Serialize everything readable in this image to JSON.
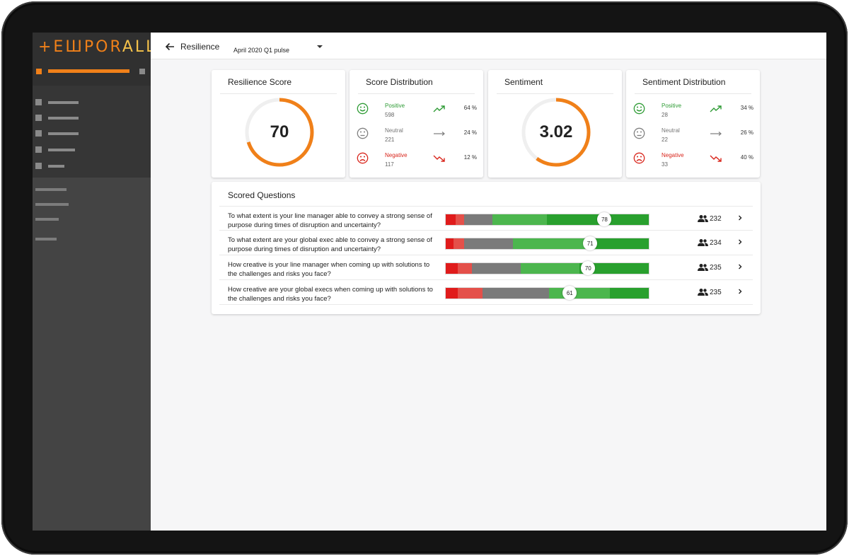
{
  "brand": {
    "logo_head": "+EШPOR",
    "logo_tail": "ALL",
    "accent": "#f08019"
  },
  "header": {
    "title": "Resilience",
    "pulse": "April 2020 Q1 pulse"
  },
  "resilience_score": {
    "title": "Resilience Score",
    "value": "70",
    "fraction": 0.7
  },
  "score_distribution": {
    "title": "Score Distribution",
    "rows": [
      {
        "label": "Positive",
        "count": "598",
        "pct": "64 %",
        "color": "#2e9b35"
      },
      {
        "label": "Neutral",
        "count": "221",
        "pct": "24 %",
        "color": "#808080"
      },
      {
        "label": "Negative",
        "count": "117",
        "pct": "12 %",
        "color": "#d9261c"
      }
    ]
  },
  "sentiment": {
    "title": "Sentiment",
    "value": "3.02",
    "fraction": 0.6
  },
  "sentiment_distribution": {
    "title": "Sentiment Distribution",
    "rows": [
      {
        "label": "Positive",
        "count": "28",
        "pct": "34 %",
        "color": "#2e9b35"
      },
      {
        "label": "Neutral",
        "count": "22",
        "pct": "26 %",
        "color": "#808080"
      },
      {
        "label": "Negative",
        "count": "33",
        "pct": "40 %",
        "color": "#d9261c"
      }
    ]
  },
  "scored_questions": {
    "title": "Scored Questions",
    "segment_colors": [
      "#e01b1b",
      "#e4504a",
      "#7a7a7a",
      "#4cb64e",
      "#29a02e"
    ],
    "items": [
      {
        "text": "To what extent is your line manager able to convey a strong sense of purpose during times of disruption and uncertainty?",
        "score": "78",
        "score_value": 78,
        "segments": [
          0.05,
          0.04,
          0.14,
          0.27,
          0.5
        ],
        "respondents": "232"
      },
      {
        "text": "To what extent are your global exec able to convey a strong sense of purpose during times of disruption and uncertainty?",
        "score": "71",
        "score_value": 71,
        "segments": [
          0.04,
          0.05,
          0.24,
          0.41,
          0.26
        ],
        "respondents": "234"
      },
      {
        "text": "How creative is your line manager when coming up with solutions to the challenges and risks you face?",
        "score": "70",
        "score_value": 70,
        "segments": [
          0.06,
          0.07,
          0.24,
          0.29,
          0.34
        ],
        "respondents": "235"
      },
      {
        "text": "How creative are your global execs when coming up with solutions to the challenges and risks you face?",
        "score": "61",
        "score_value": 61,
        "segments": [
          0.06,
          0.12,
          0.33,
          0.3,
          0.19
        ],
        "respondents": "235"
      }
    ]
  }
}
